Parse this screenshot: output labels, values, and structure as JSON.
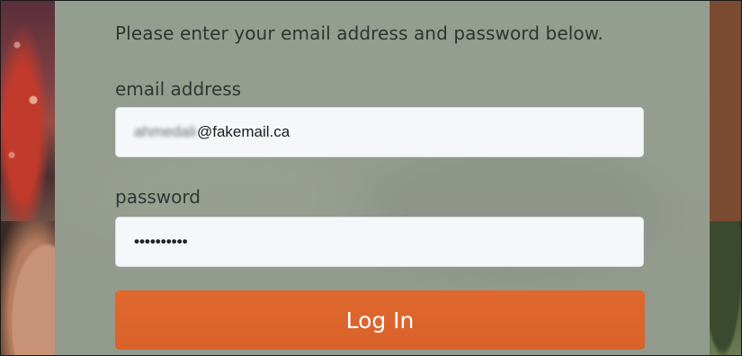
{
  "login_form": {
    "instructions": "Please enter your email address and password below.",
    "email_label": "email address",
    "email_value_obscured": "ahmedali",
    "email_value_domain": "@fakemail.ca",
    "password_label": "password",
    "password_value_masked": "••••••••••",
    "login_button_label": "Log In"
  },
  "colors": {
    "panel_background": "#969e90",
    "input_background": "#f6f7fb",
    "login_button": "#e0682e",
    "login_button_text": "#ffffff",
    "text": "#2d3532"
  }
}
